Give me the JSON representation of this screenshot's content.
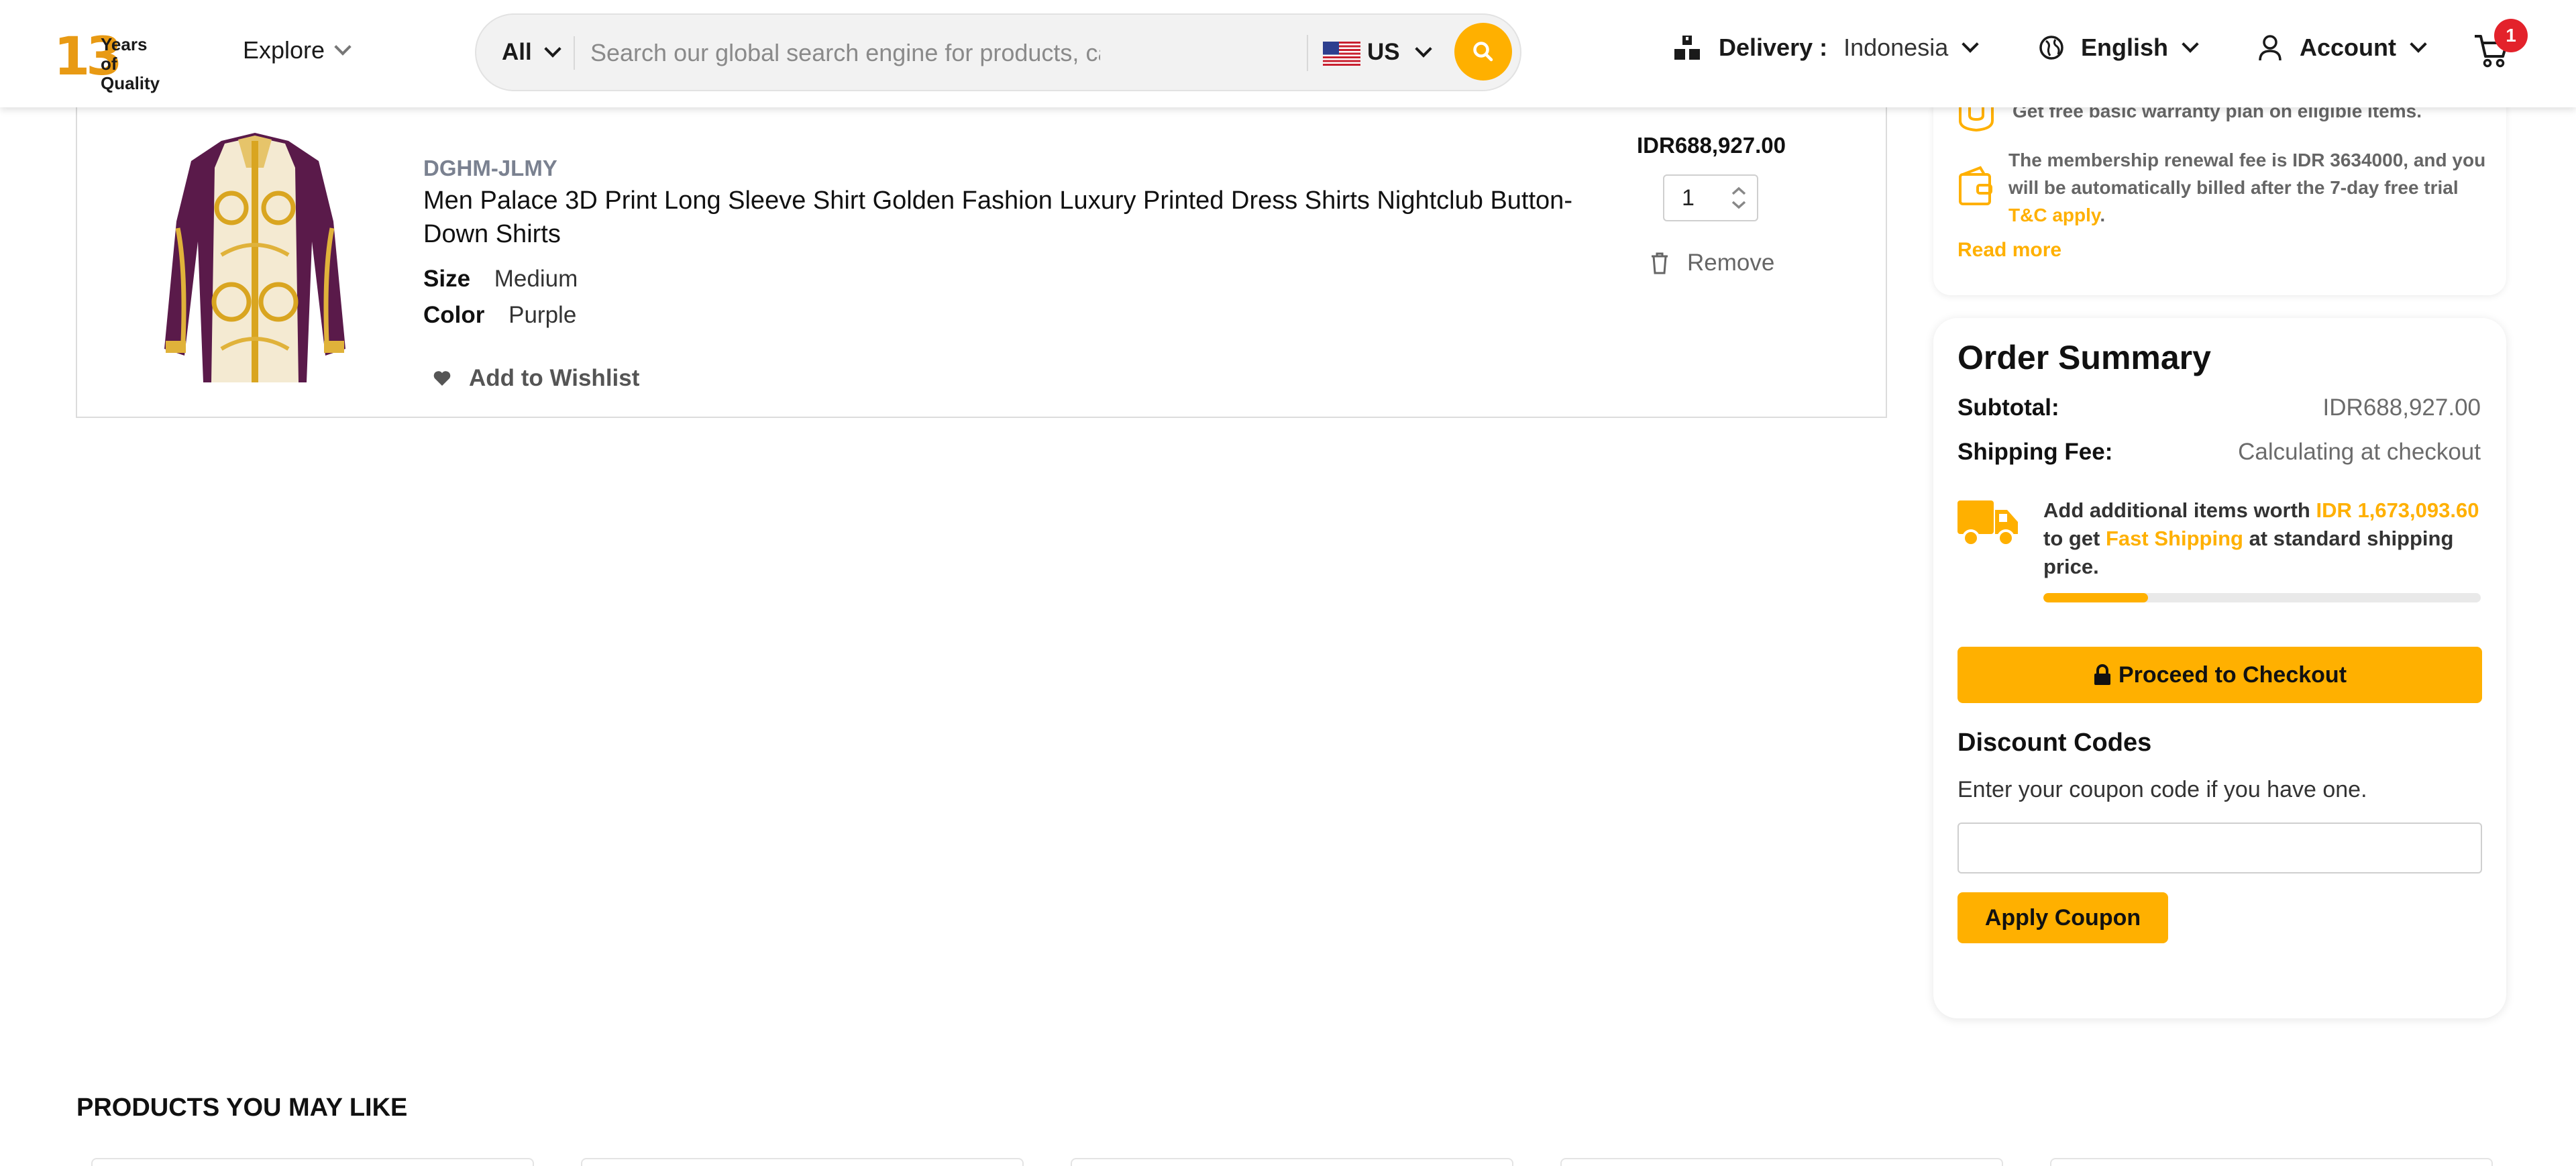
{
  "header": {
    "logo": {
      "number": "13",
      "line1": "Years of",
      "line2": "Quality"
    },
    "explore_label": "Explore",
    "search": {
      "category": "All",
      "placeholder": "Search our global search engine for products, categories",
      "region": "US"
    },
    "delivery": {
      "label": "Delivery :",
      "country": "Indonesia"
    },
    "language": "English",
    "account": "Account",
    "cart_count": "1"
  },
  "cart_item": {
    "sku": "DGHM-JLMY",
    "title": "Men Palace 3D Print Long Sleeve Shirt Golden Fashion Luxury Printed Dress Shirts Nightclub Button-Down Shirts",
    "size_label": "Size",
    "size_value": "Medium",
    "color_label": "Color",
    "color_value": "Purple",
    "wishlist_label": "Add to Wishlist",
    "price": "IDR688,927.00",
    "quantity": "1",
    "remove_label": "Remove"
  },
  "membership": {
    "warranty_text": "Get free basic warranty plan on eligible items.",
    "renewal_text": "The membership renewal fee is IDR 3634000, and you will be automatically billed after the 7-day free trial",
    "tc_link": "T&C apply",
    "read_more": "Read more"
  },
  "order_summary": {
    "title": "Order Summary",
    "subtotal_label": "Subtotal:",
    "subtotal_value": "IDR688,927.00",
    "shipping_label": "Shipping Fee:",
    "shipping_value": "Calculating at checkout",
    "free_shipping": {
      "prefix": "Add additional items worth",
      "amount": "IDR 1,673,093.60",
      "middle": "to get",
      "highlight": "Fast Shipping",
      "suffix": "at standard shipping price.",
      "progress_fraction": 0.24
    },
    "checkout_label": "Proceed to Checkout",
    "discount_title": "Discount Codes",
    "discount_hint": "Enter your coupon code if you have one.",
    "coupon_value": "",
    "apply_label": "Apply Coupon"
  },
  "related": {
    "title": "PRODUCTS YOU MAY LIKE"
  },
  "colors": {
    "accent": "#ffb000",
    "badge": "#e3222b",
    "muted": "#7a8190"
  }
}
